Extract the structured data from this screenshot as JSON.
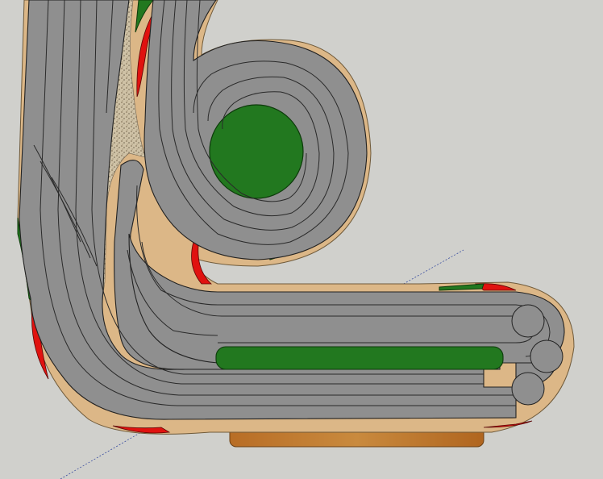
{
  "scene": {
    "background_color": "#d0d0cc",
    "track_color": "#8f8f8f",
    "lane_line_color": "#2a2a2a",
    "grass_color": "#22781f",
    "border_color": "#dcb787",
    "curb_color": "#e0120f",
    "gravel_color": "#c8b89a",
    "bench_color": "#b86d25",
    "guide_line_color": "#3b4fa0",
    "lanes": 5
  }
}
